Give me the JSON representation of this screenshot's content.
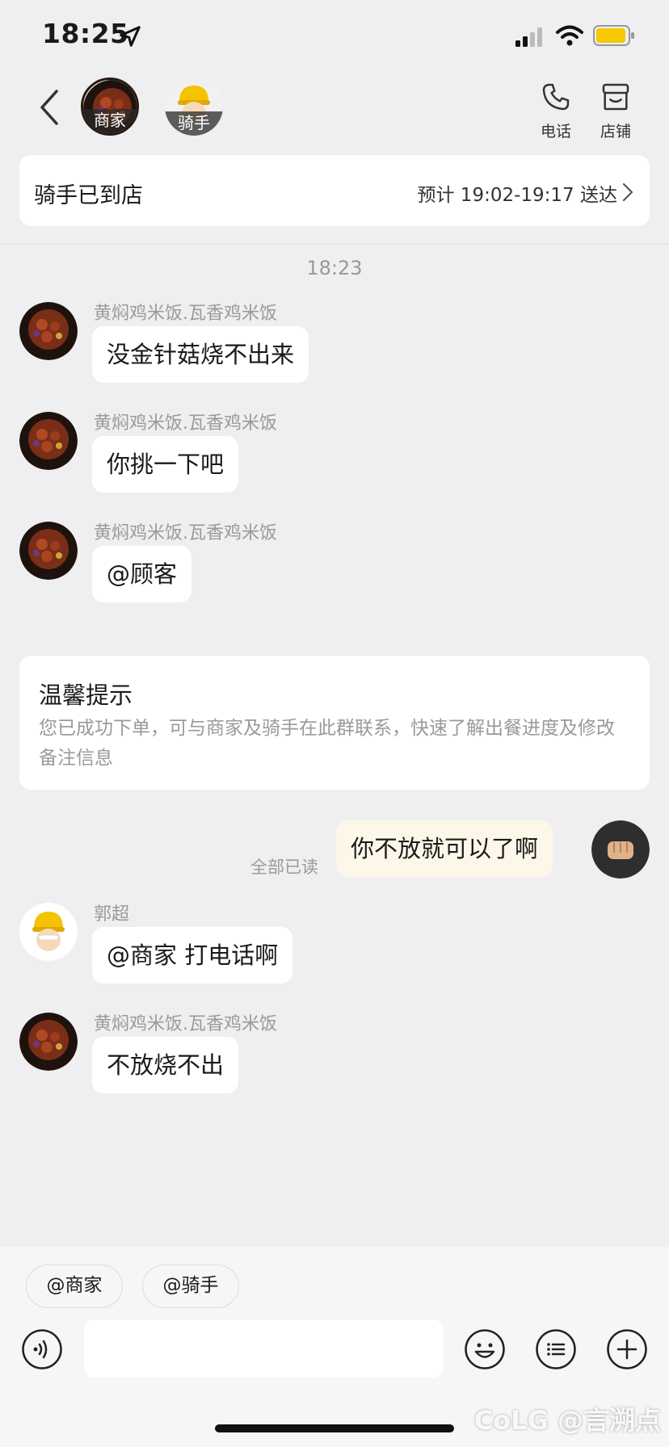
{
  "status_bar": {
    "time": "18:25"
  },
  "header": {
    "shop_tag": "商家",
    "rider_tag": "骑手",
    "phone_label": "电话",
    "store_label": "店铺"
  },
  "order_status": {
    "title": "骑手已到店",
    "eta": "预计 19:02-19:17 送达"
  },
  "chat": {
    "timestamp": "18:23",
    "messages": [
      {
        "sender": "黄焖鸡米饭.瓦香鸡米饭",
        "text": "没金针菇烧不出来"
      },
      {
        "sender": "黄焖鸡米饭.瓦香鸡米饭",
        "text": "你挑一下吧"
      },
      {
        "sender": "黄焖鸡米饭.瓦香鸡米饭",
        "text": "@顾客"
      }
    ],
    "tip": {
      "title": "温馨提示",
      "body": "您已成功下单，可与商家及骑手在此群联系，快速了解出餐进度及修改备注信息"
    },
    "my_message": {
      "text": "你不放就可以了啊",
      "read_status": "全部已读"
    },
    "messages_after": [
      {
        "sender": "郭超",
        "text": "@商家 打电话啊"
      },
      {
        "sender": "黄焖鸡米饭.瓦香鸡米饭",
        "text": "不放烧不出"
      }
    ]
  },
  "input_bar": {
    "mention_shop": "@商家",
    "mention_rider": "@骑手",
    "placeholder": ""
  },
  "watermark": "CoLG @言溯点",
  "colors": {
    "background": "#efeff1",
    "my_bubble": "#fdf7e9",
    "battery": "#f5c800"
  }
}
